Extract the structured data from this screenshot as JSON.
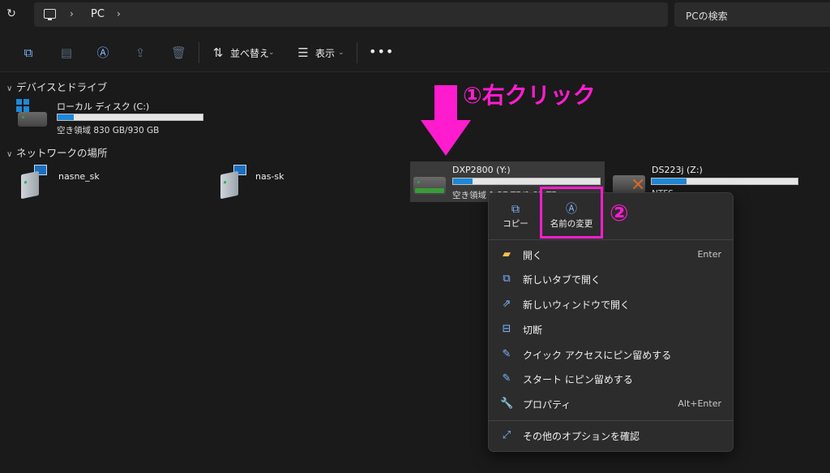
{
  "address_bar": {
    "location": "PC",
    "search_placeholder": "PCの検索"
  },
  "toolbar": {
    "sort_label": "並べ替え",
    "view_label": "表示",
    "more_label": "•••"
  },
  "sections": {
    "devices": "デバイスとドライブ",
    "network": "ネットワークの場所"
  },
  "local_disk": {
    "name": "ローカル ディスク (C:)",
    "free_text": "空き領域 830 GB/930 GB",
    "used_fraction": 0.11
  },
  "network_locations": [
    {
      "name": "nasne_sk"
    },
    {
      "name": "nas-sk"
    }
  ],
  "drive_y": {
    "name": "DXP2800 (Y:)",
    "free_text": "空き領域 1.57 TB/1.82 TB",
    "used_fraction": 0.13
  },
  "drive_z": {
    "name": "DS223j (Z:)",
    "free_text": "NTFS",
    "used_fraction": 0.24
  },
  "annotations": {
    "step1": "①右クリック",
    "step2": "②"
  },
  "context_menu": {
    "quick": [
      {
        "label": "コピー",
        "icon": "copy-icon"
      },
      {
        "label": "名前の変更",
        "icon": "rename-icon"
      }
    ],
    "items": [
      {
        "label": "開く",
        "shortcut": "Enter",
        "icon": "folder-icon"
      },
      {
        "label": "新しいタブで開く",
        "shortcut": "",
        "icon": "open-in-new-tab-icon"
      },
      {
        "label": "新しいウィンドウで開く",
        "shortcut": "",
        "icon": "open-in-new-window-icon"
      },
      {
        "label": "切断",
        "shortcut": "",
        "icon": "disconnect-icon"
      },
      {
        "label": "クイック アクセスにピン留めする",
        "shortcut": "",
        "icon": "pin-icon"
      },
      {
        "label": "スタート にピン留めする",
        "shortcut": "",
        "icon": "pin-icon"
      },
      {
        "label": "プロパティ",
        "shortcut": "Alt+Enter",
        "icon": "wrench-icon"
      }
    ],
    "more_options": {
      "label": "その他のオプションを確認",
      "icon": "expand-icon"
    }
  },
  "colors": {
    "accent": "#7fb8ff",
    "annotation": "#ff1ccf",
    "bar_fill": "#1e88d6"
  }
}
